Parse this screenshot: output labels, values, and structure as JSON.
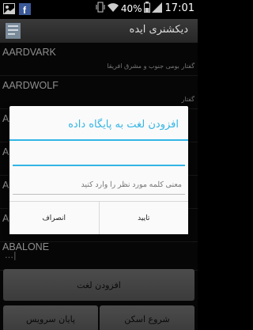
{
  "status_bar": {
    "battery": "40%",
    "time": "17:01"
  },
  "action_bar": {
    "title": "دیکشنری ایده"
  },
  "words": [
    {
      "word": "AARDVARK",
      "meaning": "گفتار بومی جنوب و مشرق افریقا"
    },
    {
      "word": "AARDWOLF",
      "meaning": "گفتار"
    },
    {
      "word": "AARON",
      "meaning": ""
    },
    {
      "word": "A",
      "meaning": ""
    },
    {
      "word": "A",
      "meaning": ""
    },
    {
      "word": "A",
      "meaning": ""
    },
    {
      "word": "ABALONE",
      "meaning": ""
    }
  ],
  "buttons": {
    "add_word": "افزودن لغت",
    "start_scan": "شروع اسکن",
    "stop_service": "پایان سرویس"
  },
  "dialog": {
    "title": "افزودن لغت به پایگاه داده",
    "word_value": "",
    "meaning_placeholder": "معنی کلمه مورد نظر را وارد کنید",
    "confirm": "تایید",
    "cancel": "انصراف"
  },
  "colors": {
    "accent": "#33b5e5"
  }
}
